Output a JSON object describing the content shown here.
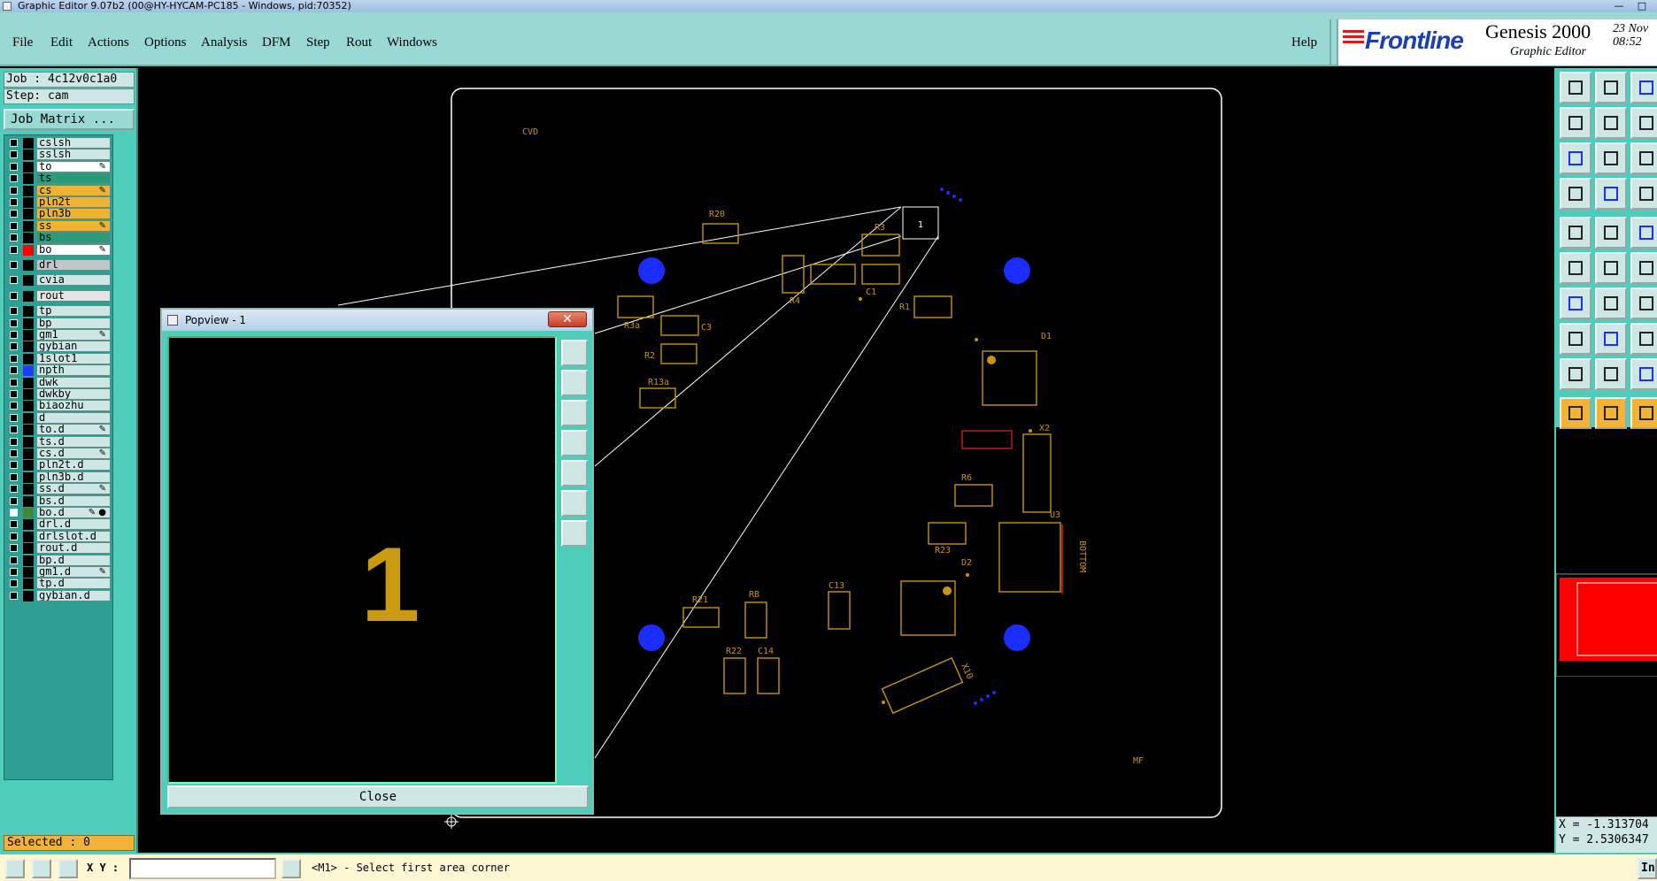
{
  "window": {
    "title": "Graphic Editor 9.07b2 (00@HY-HYCAM-PC185 - Windows, pid:70352)",
    "minimize": "—",
    "maximize": "□"
  },
  "menu": {
    "items": [
      "File",
      "Edit",
      "Actions",
      "Options",
      "Analysis",
      "DFM",
      "Step",
      "Rout",
      "Windows"
    ],
    "help": "Help"
  },
  "logo": {
    "brand": "Frontline",
    "product": "Genesis 2000",
    "subtitle": "Graphic Editor",
    "date": "23 Nov\n08:52"
  },
  "job": {
    "job_label": "Job : 4c12v0c1a0",
    "step_label": "Step: cam",
    "matrix_button": "Job Matrix ..."
  },
  "layers": [
    {
      "name": "cslsh",
      "color": "#000000",
      "bg": "#cfe7e4",
      "checked": false,
      "edit": ""
    },
    {
      "name": "sslsh",
      "color": "#000000",
      "bg": "#cfe7e4",
      "checked": false,
      "edit": ""
    },
    {
      "name": "to",
      "color": "#000000",
      "bg": "#ffffff",
      "checked": false,
      "edit": "✎"
    },
    {
      "name": "ts",
      "color": "#000000",
      "bg": "#2a9a7a",
      "checked": false,
      "edit": ""
    },
    {
      "name": "cs",
      "color": "#000000",
      "bg": "#f0b32f",
      "checked": false,
      "edit": "✎"
    },
    {
      "name": "pln2t",
      "color": "#000000",
      "bg": "#f0b32f",
      "checked": false,
      "edit": ""
    },
    {
      "name": "pln3b",
      "color": "#000000",
      "bg": "#f0b32f",
      "checked": false,
      "edit": ""
    },
    {
      "name": "ss",
      "color": "#000000",
      "bg": "#f0b32f",
      "checked": false,
      "edit": "✎"
    },
    {
      "name": "bs",
      "color": "#000000",
      "bg": "#2a9a7a",
      "checked": false,
      "edit": ""
    },
    {
      "name": "bo",
      "color": "#ff0000",
      "bg": "#ffffff",
      "checked": false,
      "edit": "✎"
    },
    {
      "name": "drl",
      "color": "#000000",
      "bg": "#bfc7c6",
      "checked": false,
      "edit": ""
    },
    {
      "name": "cvia",
      "color": "#000000",
      "bg": "#cfe7e4",
      "checked": false,
      "edit": ""
    },
    {
      "name": "rout",
      "color": "#000000",
      "bg": "#e4e4e4",
      "checked": false,
      "edit": ""
    },
    {
      "name": "tp",
      "color": "#000000",
      "bg": "#cfe7e4",
      "checked": false,
      "edit": ""
    },
    {
      "name": "bp",
      "color": "#000000",
      "bg": "#cfe7e4",
      "checked": false,
      "edit": ""
    },
    {
      "name": "gm1",
      "color": "#000000",
      "bg": "#cfe7e4",
      "checked": false,
      "edit": "✎"
    },
    {
      "name": "gybian",
      "color": "#000000",
      "bg": "#cfe7e4",
      "checked": false,
      "edit": ""
    },
    {
      "name": "1slot1",
      "color": "#000000",
      "bg": "#cfe7e4",
      "checked": false,
      "edit": ""
    },
    {
      "name": "npth",
      "color": "#1f3dff",
      "bg": "#cfe7e4",
      "checked": false,
      "edit": ""
    },
    {
      "name": "dwk",
      "color": "#000000",
      "bg": "#cfe7e4",
      "checked": false,
      "edit": ""
    },
    {
      "name": "dwkby",
      "color": "#000000",
      "bg": "#cfe7e4",
      "checked": false,
      "edit": ""
    },
    {
      "name": "biaozhu",
      "color": "#000000",
      "bg": "#cfe7e4",
      "checked": false,
      "edit": ""
    },
    {
      "name": "d",
      "color": "#000000",
      "bg": "#cfe7e4",
      "checked": false,
      "edit": ""
    },
    {
      "name": "to.d",
      "color": "#000000",
      "bg": "#cfe7e4",
      "checked": false,
      "edit": "✎"
    },
    {
      "name": "ts.d",
      "color": "#000000",
      "bg": "#cfe7e4",
      "checked": false,
      "edit": ""
    },
    {
      "name": "cs.d",
      "color": "#000000",
      "bg": "#cfe7e4",
      "checked": false,
      "edit": "✎"
    },
    {
      "name": "pln2t.d",
      "color": "#000000",
      "bg": "#cfe7e4",
      "checked": false,
      "edit": ""
    },
    {
      "name": "pln3b.d",
      "color": "#000000",
      "bg": "#cfe7e4",
      "checked": false,
      "edit": ""
    },
    {
      "name": "ss.d",
      "color": "#000000",
      "bg": "#cfe7e4",
      "checked": false,
      "edit": "✎"
    },
    {
      "name": "bs.d",
      "color": "#000000",
      "bg": "#cfe7e4",
      "checked": false,
      "edit": ""
    },
    {
      "name": "bo.d",
      "color": "#3a8a3a",
      "bg": "#cfe7e4",
      "checked": true,
      "edit": "✎ ●"
    },
    {
      "name": "drl.d",
      "color": "#000000",
      "bg": "#cfe7e4",
      "checked": false,
      "edit": ""
    },
    {
      "name": "drlslot.d",
      "color": "#000000",
      "bg": "#cfe7e4",
      "checked": false,
      "edit": ""
    },
    {
      "name": "rout.d",
      "color": "#000000",
      "bg": "#cfe7e4",
      "checked": false,
      "edit": ""
    },
    {
      "name": "bp.d",
      "color": "#000000",
      "bg": "#cfe7e4",
      "checked": false,
      "edit": ""
    },
    {
      "name": "gm1.d",
      "color": "#000000",
      "bg": "#cfe7e4",
      "checked": false,
      "edit": "✎"
    },
    {
      "name": "tp.d",
      "color": "#000000",
      "bg": "#cfe7e4",
      "checked": false,
      "edit": ""
    },
    {
      "name": "gybian.d",
      "color": "#000000",
      "bg": "#cfe7e4",
      "checked": false,
      "edit": ""
    }
  ],
  "selected": "Selected : 0",
  "board": {
    "labels": [
      "CVD",
      "R20",
      "R3",
      "R4",
      "C1",
      "C3",
      "R2",
      "R3a",
      "R13a",
      "R1",
      "D1",
      "R6",
      "X2",
      "U3",
      "R23",
      "D2",
      "BOTTOM",
      "C13",
      "R21",
      "RB",
      "R22",
      "C14",
      "X10",
      "MF"
    ],
    "popview_marker": "1",
    "colors": {
      "trace": "#c8940f",
      "hole": "#1a2cff",
      "red": "#d21a1a",
      "outline": "#ffffff"
    }
  },
  "popview": {
    "title": "Popview - 1",
    "close_x": "✕",
    "glyph": "1",
    "close_button": "Close"
  },
  "coords": {
    "x": "X = -1.313704",
    "y": "Y = 2.5306347"
  },
  "bottom": {
    "xy_label": "X Y :",
    "xy_value": "",
    "status": "<M1> - Select first area corner",
    "in_label": "Inc"
  },
  "icons": {
    "right_toolbar": [
      "open-step-icon",
      "save-icon",
      "home-icon",
      "zoom-left-icon",
      "zoom-right-icon",
      "redraw-icon",
      "fit-icon",
      "zoom-area-icon",
      "scale-icon",
      "settings-icon",
      "grid-icon",
      "snap-icon",
      "pad-icon",
      "feature-icon",
      "measure-icon",
      "connect-icon",
      "cross-icon",
      "line-edit-icon",
      "draw-line-icon",
      "draw-arc-icon",
      "rotate-icon",
      "pin-icon",
      "line-icon",
      "dimension-icon",
      "arrow-icon",
      "triangle-icon",
      "triangle-fill-icon",
      "select-pointer-icon",
      "select-box-icon",
      "select-area-icon"
    ]
  }
}
